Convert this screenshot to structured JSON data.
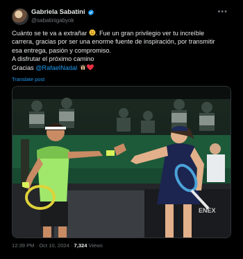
{
  "author": {
    "name": "Gabriela Sabatini",
    "handle": "@sabatinigabyok"
  },
  "icons": [
    "avatar",
    "verified-badge-icon",
    "more-options-icon",
    "smile-emoji-icon",
    "praying-hands-emoji-icon",
    "heart-emoji-icon"
  ],
  "post": {
    "line1": "Cuánto se te va a extrañar",
    "line1_cont": ". Fue un gran privilegio ver tu increíble",
    "line2": "carrera, gracias por ser una enorme fuente de inspiración, por transmitir",
    "line3": "esa entrega, pasión y compromiso.",
    "line4": "A disfrutar el próximo camino",
    "line5_prefix": "Gracias",
    "mention": "@RafaelNadal"
  },
  "translate_label": "Translate post",
  "meta": {
    "time": "12:39 PM",
    "separator": " · ",
    "date": "Oct 10, 2024",
    "views_count": "7,324",
    "views_label": "Views"
  },
  "photo_text": {
    "sponsor": "ENEX"
  },
  "colors": {
    "background": "#000000",
    "text": "#e7e9ea",
    "muted": "#71767b",
    "link": "#1d9bf0"
  }
}
